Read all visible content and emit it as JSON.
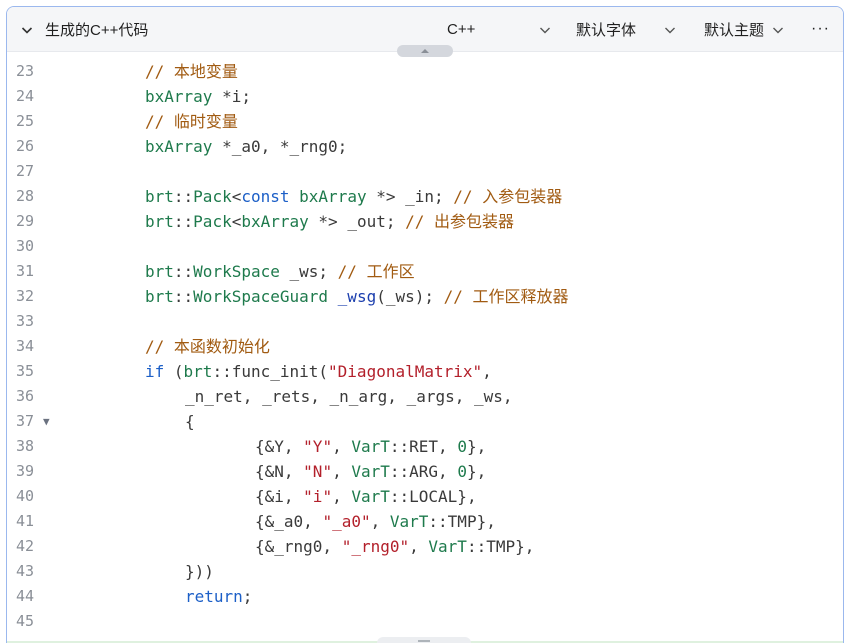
{
  "header": {
    "title": "生成的C++代码",
    "language": "C++",
    "font": "默认字体",
    "theme": "默认主题",
    "more": "···"
  },
  "code_lines": [
    {
      "n": "23",
      "indent": 1,
      "tokens": [
        {
          "t": "// 本地变量",
          "c": "cm"
        }
      ]
    },
    {
      "n": "24",
      "indent": 1,
      "tokens": [
        {
          "t": "bxArray",
          "c": "ty"
        },
        {
          "t": " *i;",
          "c": "pl"
        }
      ]
    },
    {
      "n": "25",
      "indent": 1,
      "tokens": [
        {
          "t": "// 临时变量",
          "c": "cm"
        }
      ]
    },
    {
      "n": "26",
      "indent": 1,
      "tokens": [
        {
          "t": "bxArray",
          "c": "ty"
        },
        {
          "t": " *_a0, *_rng0;",
          "c": "pl"
        }
      ]
    },
    {
      "n": "27",
      "indent": 0,
      "tokens": []
    },
    {
      "n": "28",
      "indent": 1,
      "tokens": [
        {
          "t": "brt",
          "c": "ty"
        },
        {
          "t": "::",
          "c": "pl"
        },
        {
          "t": "Pack",
          "c": "ty"
        },
        {
          "t": "<",
          "c": "pl"
        },
        {
          "t": "const",
          "c": "kw"
        },
        {
          "t": " ",
          "c": "pl"
        },
        {
          "t": "bxArray",
          "c": "ty"
        },
        {
          "t": " *> _in; ",
          "c": "pl"
        },
        {
          "t": "// 入参包装器",
          "c": "cm"
        }
      ]
    },
    {
      "n": "29",
      "indent": 1,
      "tokens": [
        {
          "t": "brt",
          "c": "ty"
        },
        {
          "t": "::",
          "c": "pl"
        },
        {
          "t": "Pack",
          "c": "ty"
        },
        {
          "t": "<",
          "c": "pl"
        },
        {
          "t": "bxArray",
          "c": "ty"
        },
        {
          "t": " *> _out; ",
          "c": "pl"
        },
        {
          "t": "// 出参包装器",
          "c": "cm"
        }
      ]
    },
    {
      "n": "30",
      "indent": 0,
      "tokens": []
    },
    {
      "n": "31",
      "indent": 1,
      "tokens": [
        {
          "t": "brt",
          "c": "ty"
        },
        {
          "t": "::",
          "c": "pl"
        },
        {
          "t": "WorkSpace",
          "c": "ty"
        },
        {
          "t": " _ws; ",
          "c": "pl"
        },
        {
          "t": "// 工作区",
          "c": "cm"
        }
      ]
    },
    {
      "n": "32",
      "indent": 1,
      "tokens": [
        {
          "t": "brt",
          "c": "ty"
        },
        {
          "t": "::",
          "c": "pl"
        },
        {
          "t": "WorkSpaceGuard",
          "c": "ty"
        },
        {
          "t": " ",
          "c": "pl"
        },
        {
          "t": "_wsg",
          "c": "fn"
        },
        {
          "t": "(_ws); ",
          "c": "pl"
        },
        {
          "t": "// 工作区释放器",
          "c": "cm"
        }
      ]
    },
    {
      "n": "33",
      "indent": 0,
      "tokens": []
    },
    {
      "n": "34",
      "indent": 1,
      "tokens": [
        {
          "t": "// 本函数初始化",
          "c": "cm"
        }
      ]
    },
    {
      "n": "35",
      "indent": 1,
      "tokens": [
        {
          "t": "if",
          "c": "kw"
        },
        {
          "t": " (",
          "c": "pl"
        },
        {
          "t": "brt",
          "c": "ty"
        },
        {
          "t": "::func_init(",
          "c": "pl"
        },
        {
          "t": "\"DiagonalMatrix\"",
          "c": "st"
        },
        {
          "t": ",",
          "c": "pl"
        }
      ]
    },
    {
      "n": "36",
      "indent": 2,
      "tokens": [
        {
          "t": "_n_ret, _rets, _n_arg, _args, _ws,",
          "c": "pl"
        }
      ]
    },
    {
      "n": "37",
      "indent": 2,
      "fold": "▼",
      "tokens": [
        {
          "t": "{",
          "c": "pl"
        }
      ]
    },
    {
      "n": "38",
      "indent": 3,
      "tokens": [
        {
          "t": "{&Y, ",
          "c": "pl"
        },
        {
          "t": "\"Y\"",
          "c": "st"
        },
        {
          "t": ", ",
          "c": "pl"
        },
        {
          "t": "VarT",
          "c": "ty"
        },
        {
          "t": "::RET, ",
          "c": "pl"
        },
        {
          "t": "0",
          "c": "nu"
        },
        {
          "t": "},",
          "c": "pl"
        }
      ]
    },
    {
      "n": "39",
      "indent": 3,
      "tokens": [
        {
          "t": "{&N, ",
          "c": "pl"
        },
        {
          "t": "\"N\"",
          "c": "st"
        },
        {
          "t": ", ",
          "c": "pl"
        },
        {
          "t": "VarT",
          "c": "ty"
        },
        {
          "t": "::ARG, ",
          "c": "pl"
        },
        {
          "t": "0",
          "c": "nu"
        },
        {
          "t": "},",
          "c": "pl"
        }
      ]
    },
    {
      "n": "40",
      "indent": 3,
      "tokens": [
        {
          "t": "{&i, ",
          "c": "pl"
        },
        {
          "t": "\"i\"",
          "c": "st"
        },
        {
          "t": ", ",
          "c": "pl"
        },
        {
          "t": "VarT",
          "c": "ty"
        },
        {
          "t": "::LOCAL},",
          "c": "pl"
        }
      ]
    },
    {
      "n": "41",
      "indent": 3,
      "tokens": [
        {
          "t": "{&_a0, ",
          "c": "pl"
        },
        {
          "t": "\"_a0\"",
          "c": "st"
        },
        {
          "t": ", ",
          "c": "pl"
        },
        {
          "t": "VarT",
          "c": "ty"
        },
        {
          "t": "::TMP},",
          "c": "pl"
        }
      ]
    },
    {
      "n": "42",
      "indent": 3,
      "tokens": [
        {
          "t": "{&_rng0, ",
          "c": "pl"
        },
        {
          "t": "\"_rng0\"",
          "c": "st"
        },
        {
          "t": ", ",
          "c": "pl"
        },
        {
          "t": "VarT",
          "c": "ty"
        },
        {
          "t": "::TMP},",
          "c": "pl"
        }
      ]
    },
    {
      "n": "43",
      "indent": 2,
      "tokens": [
        {
          "t": "}))",
          "c": "pl"
        }
      ]
    },
    {
      "n": "44",
      "indent": 2,
      "tokens": [
        {
          "t": "return",
          "c": "kw"
        },
        {
          "t": ";",
          "c": "pl"
        }
      ]
    },
    {
      "n": "45",
      "indent": 0,
      "tokens": []
    }
  ],
  "icons": {
    "collapse": "chevron-down-icon",
    "dropdown": "chevron-down-icon",
    "more": "more-icon",
    "fold": "fold-arrow-icon",
    "top_handle": "chevron-up-icon",
    "bottom_handle": "drag-handle-icon"
  },
  "colors": {
    "comment": "#a15b12",
    "keyword": "#1c5fc7",
    "type": "#1e7a4c",
    "string": "#b3202b",
    "function": "#1c3fae",
    "border": "#9bb8ee"
  }
}
